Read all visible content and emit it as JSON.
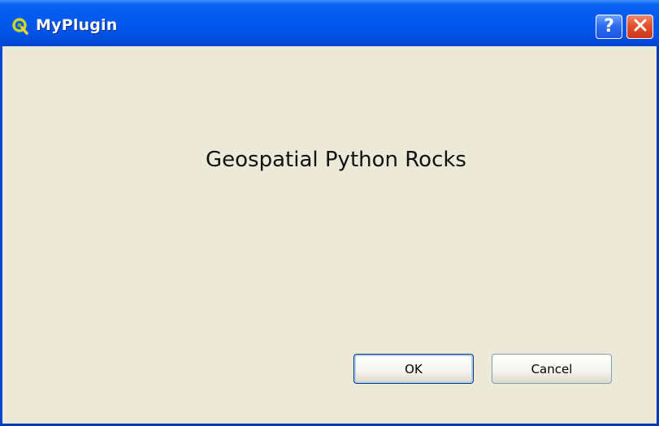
{
  "window": {
    "title": "MyPlugin",
    "app_icon": "qgis-icon",
    "help_button_glyph": "?",
    "close_button_icon": "close-icon"
  },
  "content": {
    "headline": "Geospatial Python Rocks"
  },
  "buttons": {
    "ok_label": "OK",
    "cancel_label": "Cancel"
  },
  "colors": {
    "titlebar": "#0058ee",
    "client_background": "#ece9d8",
    "close_button": "#e2502c",
    "app_icon": "#93b023"
  }
}
